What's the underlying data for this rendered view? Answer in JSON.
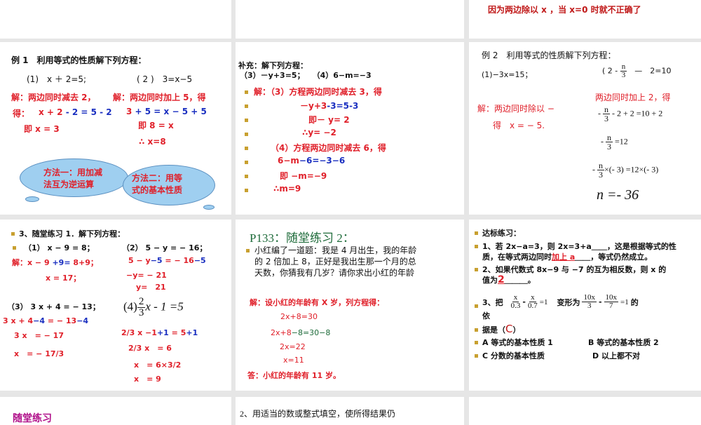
{
  "top_right": {
    "text": "因为两边除以 x ，当 x=0 时就不正确了"
  },
  "slide1": {
    "title": "例 1　利用等式的性质解下列方程：",
    "q1": "(1)　x ＋ 2=5;",
    "q2": "( 2 )　3=x−5",
    "s1a": "解：两边同时减去 2，",
    "s1b": "得：",
    "s1c_red": "x + 2",
    "s1c_blue": "- 2 = 5 - 2",
    "s1d": "即 x = 3",
    "s2a": "解：两边同时加上 5，得",
    "s2b_red": "3",
    "s2b_blue": "+ 5 = x − 5 + 5",
    "s2c": "即 8 = x",
    "s2d": "∴ x=8",
    "cloud1": "方法一：用加减\n法互为逆运算",
    "cloud2": "方法二：用等\n式的基本性质"
  },
  "slide2": {
    "title": "补充：解下列方程：",
    "q": "（3）－y+3=5；　　（4）6−m=−3",
    "lines": [
      "解：（3）方程两边同时减去 3，得",
      "－y+3",
      "-3=5-3",
      "即－ y= 2",
      "∴y= −2",
      "（4）方程两边同时减去 6，得",
      "6−m",
      "−6=−3−6",
      "即 −m=−9",
      "∴m=9"
    ]
  },
  "slide3": {
    "title": "例 2　利用等式的性质解下列方程：",
    "q1": "(1)−3x=15；",
    "q2_pre": "( 2 -",
    "q2_post": "—　2=10",
    "frac_num": "n",
    "frac_den": "3",
    "left_a": "解：两边同时除以 −",
    "left_b": "得　x = − 5.",
    "right_a": "两边同时加上 2，得",
    "e1": "- 2 + 2 =10 + 2",
    "e2": "=12",
    "e3": "×(- 3) =12×(- 3)",
    "result": "n =- 36"
  },
  "slide4": {
    "title": "3、随堂练习 1．解下列方程：",
    "q1": "（1） x − 9 = 8；",
    "q2": "（2） 5 − y = − 16；",
    "a1_red": "解：x − 9",
    "a1_blue": "+9=",
    "a1_end": "8+9；",
    "a2": "x = 17；",
    "b1_red": "5 − y",
    "b1_blue": "−5",
    "b1_mid": " = − 16",
    "b1_end": "−5",
    "b2": "−y= − 21",
    "b3": "y=　21",
    "q3": "（3） 3 x + 4 = − 13；",
    "q4_pre": "(4)",
    "q4_post": "x - 1 =5",
    "q4_num": "2",
    "q4_den": "3",
    "c1_red": "3 x + 4",
    "c1_blue": "−4",
    "c1_mid": " = − 13",
    "c1_end": "−4",
    "c2": "3 x　= − 17",
    "c3": "x　= − 17/3",
    "d1_red": "2/3 x −1",
    "d1_blue": "+1",
    "d1_mid": " = 5",
    "d1_end": "+1",
    "d2": "2/3 x　= 6",
    "d3": "x　= 6×3/2",
    "d4": "x　= 9"
  },
  "slide5": {
    "title": "P133：随堂练习 2：",
    "para": [
      "小红编了一道题：我是 4 月出生，我的年龄",
      "的 2 倍加上 8，正好是我出生那一个月的总",
      "天数，你猜我有几岁？请你求出小红的年龄"
    ],
    "sol": "解：设小红的年龄有 X 岁，列方程得：",
    "e1": "2x+8=30",
    "e2a": "2x+8",
    "e2b": "−8=30−8",
    "e3": "2x=22",
    "e4": "x=11",
    "ans": "答：小红的年龄有 11 岁。"
  },
  "slide6": {
    "title": "达标练习：",
    "l1": "1、若 2x−a=3，则 2x=3+a＿＿，这是根据等式的性",
    "l1b": "质，在等式两边同时",
    "l1_fill": "加上 a",
    "l1c": "＿＿，等式仍然成立。",
    "l2": "2、如果代数式 8x−9 与 −7 的互为相反数，则 x 的",
    "l2b": "值为",
    "l2_fill": "2",
    "l2c": "＿＿＿。",
    "l3a": "3、把",
    "l3b": "变形为",
    "l3c": "的",
    "l3d": "依",
    "f1n": "x",
    "f1d": "0.3",
    "f2n": "x",
    "f2d": "0.7",
    "eq1": "=1",
    "f3n": "10x",
    "f3d": "3",
    "f4n": "10x",
    "f4d": "7",
    "l4": "据是（",
    "l4_fill": "C",
    "l4_end": "）",
    "optA": "A 等式的基本性质 1",
    "optB": "B 等式的基本性质 2",
    "optC": "C 分数的基本性质",
    "optD": "D 以上都不对"
  },
  "slide7": {
    "title": "随堂练习"
  },
  "slide8": {
    "text": "2、用适当的数或整式填空，使所得结果仍"
  }
}
